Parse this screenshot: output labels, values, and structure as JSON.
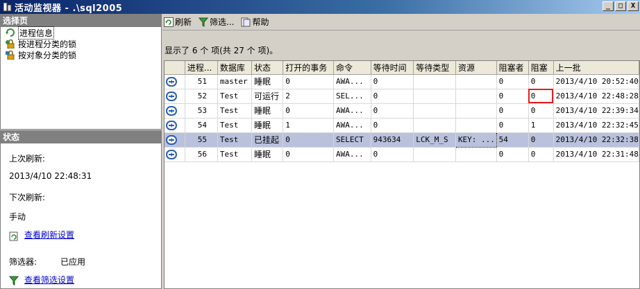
{
  "window": {
    "title": "活动监视器 - .\\sql2005",
    "btn_min": "_",
    "btn_max": "□",
    "btn_close": "X"
  },
  "left": {
    "select_pages_title": "选择页",
    "pages": [
      {
        "label": "进程信息",
        "icon": "process-info-icon"
      },
      {
        "label": "按进程分类的锁",
        "icon": "lock-by-process-icon"
      },
      {
        "label": "按对象分类的锁",
        "icon": "lock-by-object-icon"
      }
    ],
    "status_title": "状态",
    "last_refresh_label": "上次刷新:",
    "last_refresh_value": "2013/4/10 22:48:31",
    "next_refresh_label": "下次刷新:",
    "next_refresh_value": "手动",
    "view_refresh_settings": "查看刷新设置",
    "filter_label": "筛选器:",
    "filter_value": "已应用",
    "view_filter_settings": "查看筛选设置"
  },
  "toolbar": {
    "refresh": "刷新",
    "filter": "筛选...",
    "help": "帮助"
  },
  "summary": "显示了 6 个 项(共 27 个 项)。",
  "grid": {
    "columns": [
      "进程...",
      "数据库",
      "状态",
      "打开的事务",
      "命令",
      "等待时间",
      "等待类型",
      "资源",
      "阻塞者",
      "阻塞",
      "上一批"
    ],
    "rows": [
      [
        "51",
        "master",
        "睡眠",
        "0",
        "AWA...",
        "0",
        "",
        "",
        "0",
        "0",
        "2013/4/10 20:52:40"
      ],
      [
        "52",
        "Test",
        "可运行",
        "2",
        "SEL...",
        "0",
        "",
        "",
        "0",
        "0",
        "2013/4/10 22:48:28"
      ],
      [
        "53",
        "Test",
        "睡眠",
        "0",
        "AWA...",
        "0",
        "",
        "",
        "0",
        "0",
        "2013/4/10 22:39:34"
      ],
      [
        "54",
        "Test",
        "睡眠",
        "1",
        "AWA...",
        "0",
        "",
        "",
        "0",
        "1",
        "2013/4/10 22:32:45"
      ],
      [
        "55",
        "Test",
        "已挂起",
        "0",
        "SELECT",
        "943634",
        "LCK_M_S",
        "KEY: ...",
        "54",
        "0",
        "2013/4/10 22:32:38"
      ],
      [
        "56",
        "Test",
        "睡眠",
        "0",
        "AWA...",
        "0",
        "",
        "",
        "0",
        "0",
        "2013/4/10 22:31:48"
      ]
    ],
    "selected_row": 4
  }
}
